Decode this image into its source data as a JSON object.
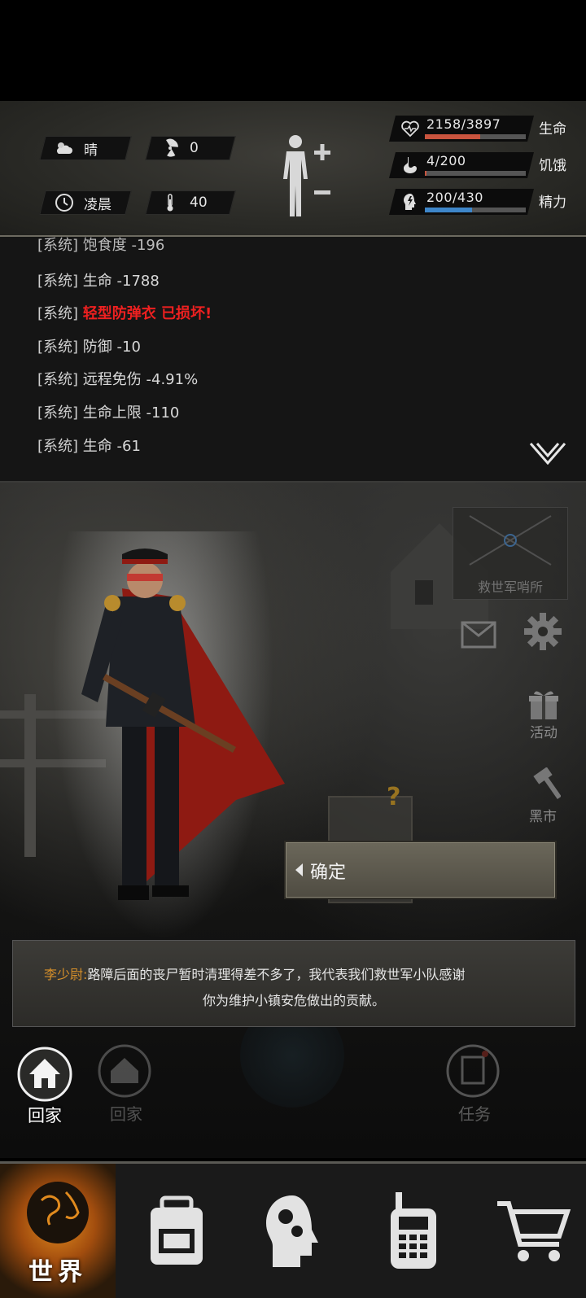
{
  "status": {
    "weather_label": "晴",
    "radiation_value": "0",
    "time_label": "凌晨",
    "temperature_value": "40",
    "stats": [
      {
        "value": "2158/3897",
        "name": "生命",
        "fill": 0.55,
        "color": "#c9543e",
        "icon": "heart-pulse-icon"
      },
      {
        "value": "4/200",
        "name": "饥饿",
        "fill": 0.02,
        "color": "#c9543e",
        "icon": "stomach-icon"
      },
      {
        "value": "200/430",
        "name": "精力",
        "fill": 0.47,
        "color": "#3e86c9",
        "icon": "head-bolt-icon"
      }
    ]
  },
  "log": {
    "partial_line": "[系统] 饱食度 -196",
    "lines": [
      {
        "tag": "[系统]",
        "msg": "生命 -1788"
      },
      {
        "tag": "[系统]",
        "msg": "轻型防弹衣 已损坏!"
      },
      {
        "tag": "[系统]",
        "msg": "防御 -10"
      },
      {
        "tag": "[系统]",
        "msg": "远程免伤 -4.91%"
      },
      {
        "tag": "[系统]",
        "msg": "生命上限 -110"
      },
      {
        "tag": "[系统]",
        "msg": "生命 -61"
      }
    ]
  },
  "scene": {
    "outpost_label": "救世军哨所",
    "event_label": "活动",
    "black_market_label": "黑市",
    "confirm_label": "确定",
    "dialog_speaker": "李少尉:",
    "dialog_text_1": "路障后面的丧尸暂时清理得差不多了，我代表我们救世军小队感谢",
    "dialog_text_2": "你为维护小镇安危做出的贡献。",
    "home_label": "回家",
    "home_label_faded": "回家",
    "task_label": "任务"
  },
  "nav": {
    "world_label": "世界"
  }
}
